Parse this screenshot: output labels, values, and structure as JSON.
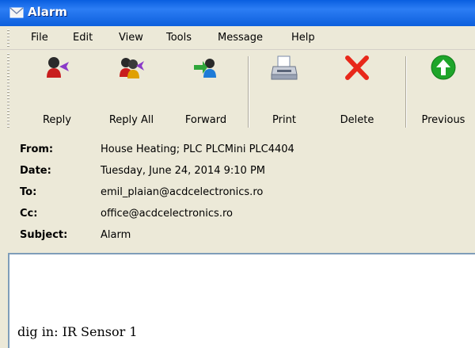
{
  "window": {
    "title": "Alarm",
    "title_icon": "envelope-icon"
  },
  "menu": [
    "File",
    "Edit",
    "View",
    "Tools",
    "Message",
    "Help"
  ],
  "toolbar": [
    {
      "label": "Reply",
      "icon": "reply-icon"
    },
    {
      "label": "Reply All",
      "icon": "reply-all-icon"
    },
    {
      "label": "Forward",
      "icon": "forward-icon"
    },
    {
      "label": "Print",
      "icon": "printer-icon"
    },
    {
      "label": "Delete",
      "icon": "delete-x-icon"
    },
    {
      "label": "Previous",
      "icon": "previous-arrow-icon"
    }
  ],
  "header": {
    "from_label": "From:",
    "from": "House Heating; PLC PLCMini PLC4404",
    "date_label": "Date:",
    "date": "Tuesday, June 24, 2014 9:10 PM",
    "to_label": "To:",
    "to": "emil_plaian@acdcelectronics.ro",
    "cc_label": "Cc:",
    "cc": "office@acdcelectronics.ro",
    "subject_label": "Subject:",
    "subject": "Alarm"
  },
  "body": {
    "text": "dig in: IR Sensor 1"
  },
  "colors": {
    "titlebar": "#0a5fe0",
    "delete": "#e8281a",
    "previous": "#1ea52a"
  }
}
